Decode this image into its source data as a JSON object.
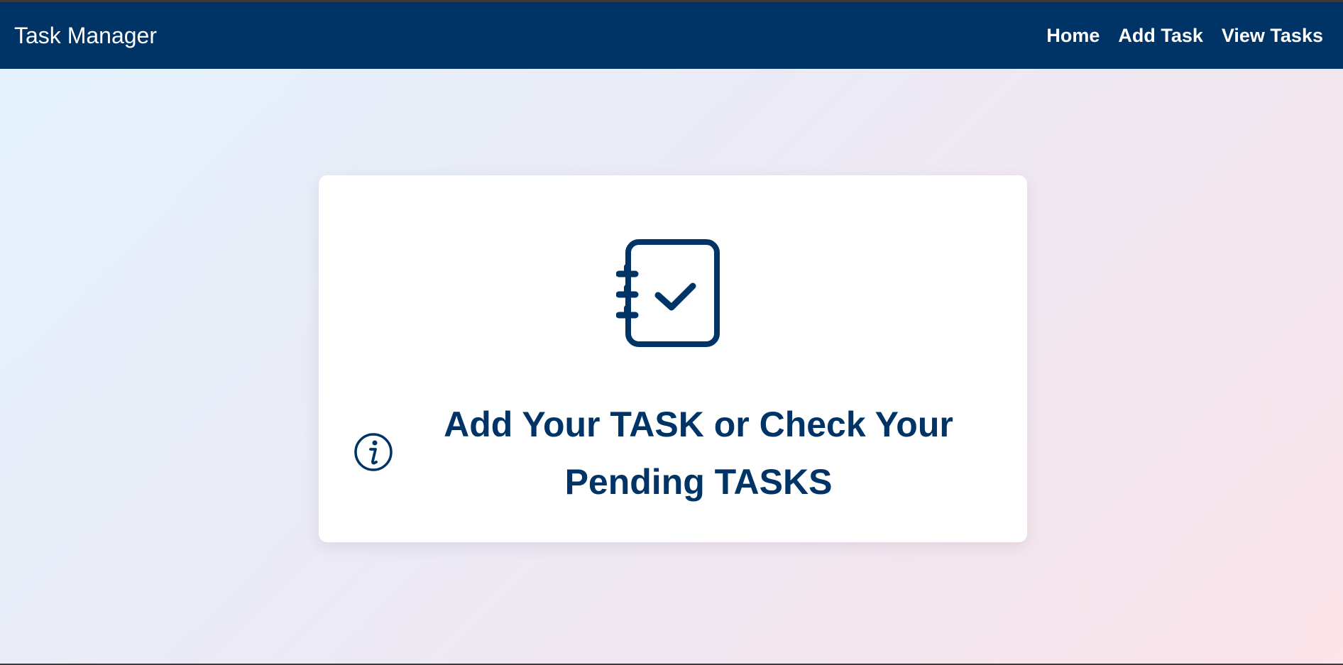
{
  "navbar": {
    "brand": "Task Manager",
    "links": [
      {
        "label": "Home"
      },
      {
        "label": "Add Task"
      },
      {
        "label": "View Tasks"
      }
    ]
  },
  "hero": {
    "icon": "notebook-check-icon",
    "info_icon": "info-icon",
    "headline": "Add Your TASK or Check Your Pending TASKS"
  },
  "colors": {
    "navbar_bg": "#003366",
    "accent": "#003366",
    "card_bg": "#ffffff"
  }
}
